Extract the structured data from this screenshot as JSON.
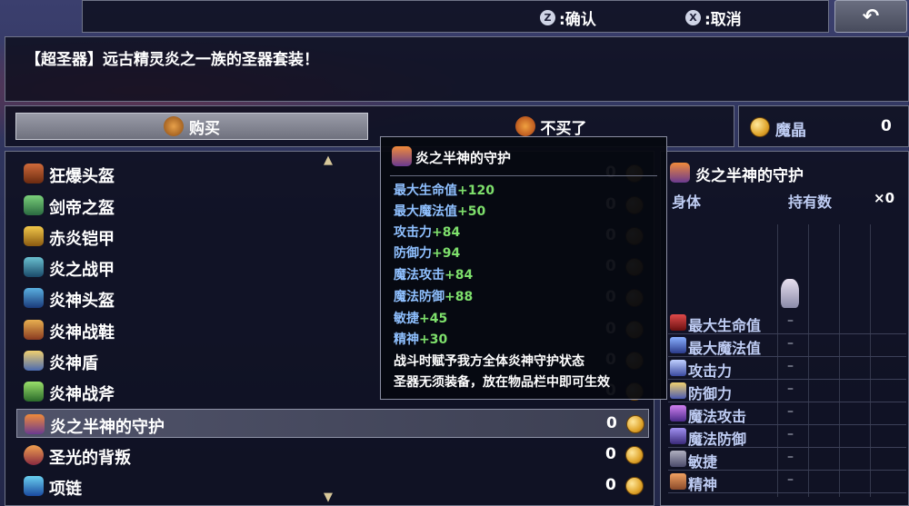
{
  "hints": {
    "confirm_key": "Z",
    "confirm_label": ":确认",
    "cancel_key": "X",
    "cancel_label": ":取消",
    "back_icon": "back-arrow-icon"
  },
  "description": "【超圣器】远古精灵炎之一族的圣器套装！",
  "tabs": {
    "buy": "购买",
    "no_buy": "不买了"
  },
  "currency": {
    "name": "魔晶",
    "amount": "0"
  },
  "items": [
    {
      "name": "狂爆头盔",
      "count": "0"
    },
    {
      "name": "剑帝之盔",
      "count": "0"
    },
    {
      "name": "赤炎铠甲",
      "count": "0"
    },
    {
      "name": "炎之战甲",
      "count": "0"
    },
    {
      "name": "炎神头盔",
      "count": "0"
    },
    {
      "name": "炎神战鞋",
      "count": "0"
    },
    {
      "name": "炎神盾",
      "count": "0"
    },
    {
      "name": "炎神战斧",
      "count": "0"
    },
    {
      "name": "炎之半神的守护",
      "count": "0",
      "selected": true
    },
    {
      "name": "圣光的背叛",
      "count": "0"
    },
    {
      "name": "项链",
      "count": "0"
    }
  ],
  "tooltip": {
    "title": "炎之半神的守护",
    "stats": [
      {
        "label": "最大生命值",
        "value": "+120"
      },
      {
        "label": "最大魔法值",
        "value": "+50"
      },
      {
        "label": "攻击力",
        "value": "+84"
      },
      {
        "label": "防御力",
        "value": "+94"
      },
      {
        "label": "魔法攻击",
        "value": "+84"
      },
      {
        "label": "魔法防御",
        "value": "+88"
      },
      {
        "label": "敏捷",
        "value": "+45"
      },
      {
        "label": "精神",
        "value": "+30"
      }
    ],
    "note1": "战斗时赋予我方全体炎神守护状态",
    "note2": "圣器无须装备，放在物品栏中即可生效"
  },
  "detail": {
    "title": "炎之半神的守护",
    "slot": "身体",
    "owned_label": "持有数",
    "owned": "×0",
    "stats": [
      {
        "label": "最大生命值",
        "value": "–"
      },
      {
        "label": "最大魔法值",
        "value": "–"
      },
      {
        "label": "攻击力",
        "value": "–"
      },
      {
        "label": "防御力",
        "value": "–"
      },
      {
        "label": "魔法攻击",
        "value": "–"
      },
      {
        "label": "魔法防御",
        "value": "–"
      },
      {
        "label": "敏捷",
        "value": "–"
      },
      {
        "label": "精神",
        "value": "–"
      }
    ]
  },
  "colors": {
    "accent_green": "#7ee06c",
    "accent_blue": "#8fc0ff",
    "coin": "#e0a52c"
  }
}
